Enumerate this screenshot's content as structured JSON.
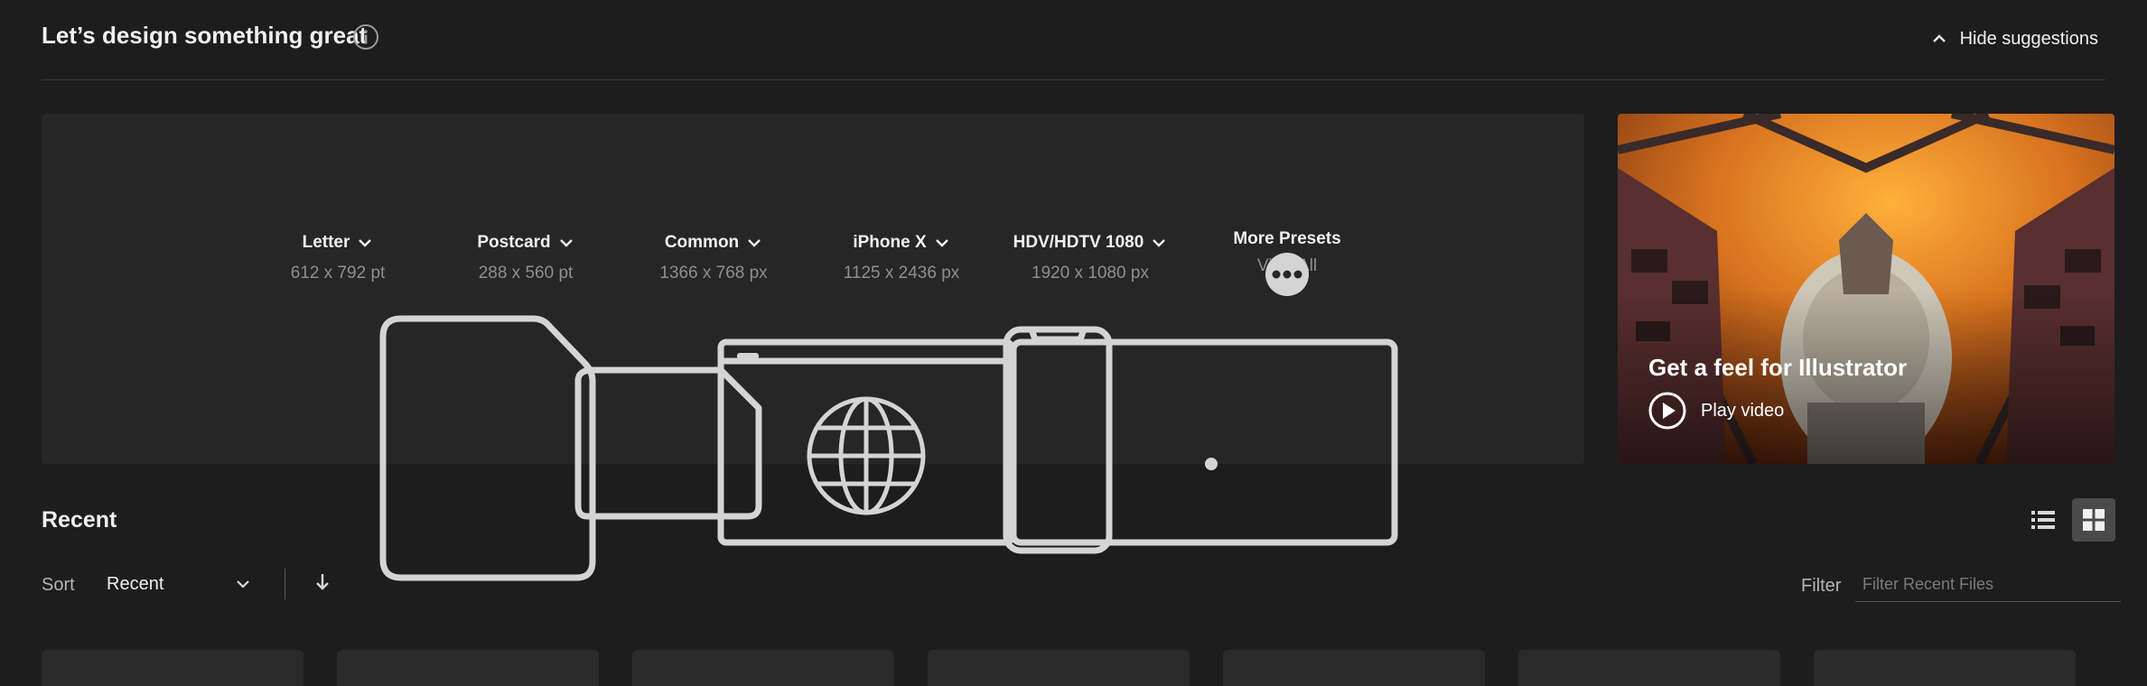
{
  "header": {
    "title": "Let’s design something great",
    "hide_suggestions_label": "Hide suggestions"
  },
  "presets": [
    {
      "name": "Letter",
      "size": "612 x 792 pt",
      "icon": "document-icon"
    },
    {
      "name": "Postcard",
      "size": "288 x 560 pt",
      "icon": "postcard-icon"
    },
    {
      "name": "Common",
      "size": "1366 x 768 px",
      "icon": "web-icon"
    },
    {
      "name": "iPhone X",
      "size": "1125 x 2436 px",
      "icon": "phone-icon"
    },
    {
      "name": "HDV/HDTV 1080",
      "size": "1920 x 1080 px",
      "icon": "video-icon"
    }
  ],
  "more_presets": {
    "name": "More Presets",
    "link": "View All",
    "icon": "more-icon"
  },
  "video": {
    "title": "Get a feel for Illustrator",
    "play_label": "Play video"
  },
  "recent": {
    "heading": "Recent",
    "sort_label": "Sort",
    "sort_value": "Recent",
    "filter_label": "Filter",
    "filter_placeholder": "Filter Recent Files",
    "view_modes": [
      "list-view-icon",
      "grid-view-icon"
    ],
    "active_view": "grid-view-icon"
  },
  "colors": {
    "background": "#1d1d1d",
    "panel": "#262626",
    "icon_stroke": "#d4d4d4",
    "active_toggle": "#4a4a4a"
  }
}
